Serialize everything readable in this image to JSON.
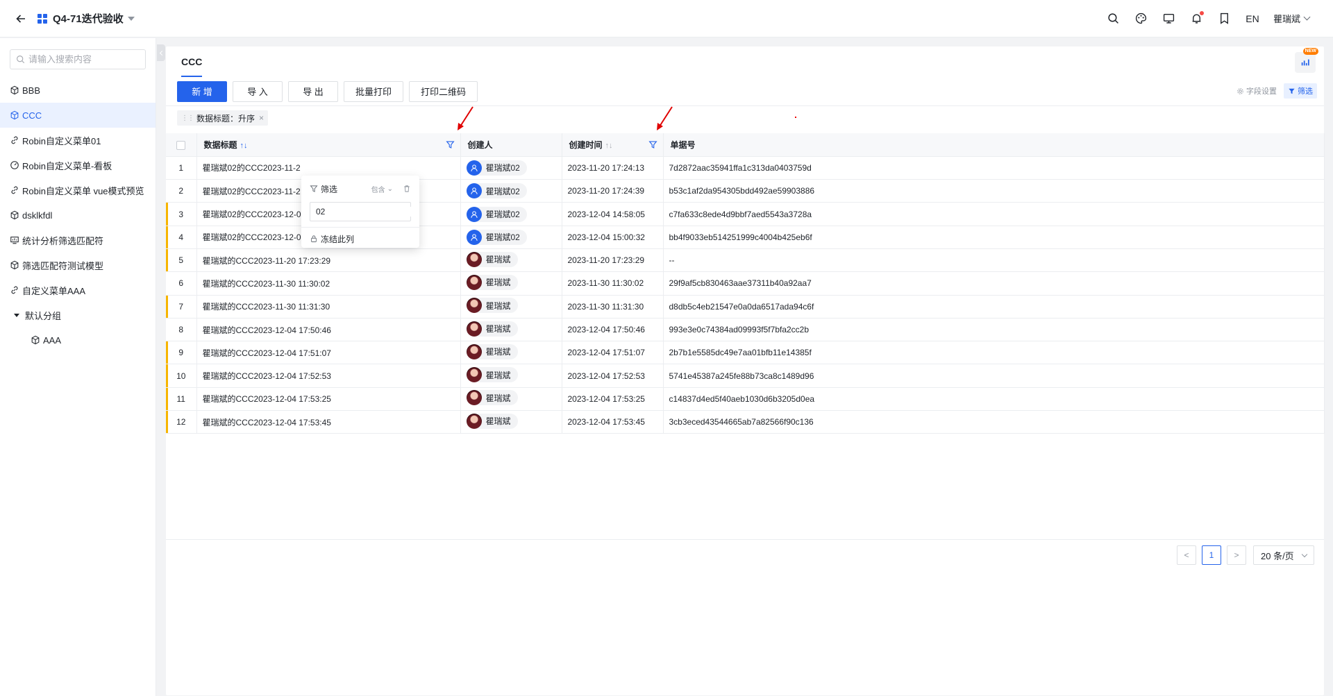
{
  "header": {
    "app_title": "Q4-71迭代验收",
    "lang": "EN",
    "user": "瞿瑞斌",
    "icons": [
      "search-icon",
      "palette-icon",
      "monitor-icon",
      "bell-icon",
      "bookmark-icon"
    ]
  },
  "sidebar": {
    "search_placeholder": "请输入搜索内容",
    "items": [
      {
        "label": "BBB",
        "icon": "cube-icon"
      },
      {
        "label": "CCC",
        "icon": "cube-icon",
        "active": true
      },
      {
        "label": "Robin自定义菜单01",
        "icon": "link-icon"
      },
      {
        "label": "Robin自定义菜单-看板",
        "icon": "dashboard-icon"
      },
      {
        "label": "Robin自定义菜单 vue模式预览",
        "icon": "link-icon"
      },
      {
        "label": "dsklkfdl",
        "icon": "cube-icon"
      },
      {
        "label": "统计分析筛选匹配符",
        "icon": "chart-icon"
      },
      {
        "label": "筛选匹配符测试模型",
        "icon": "cube-icon"
      },
      {
        "label": "自定义菜单AAA",
        "icon": "link-icon"
      }
    ],
    "group": {
      "label": "默认分组",
      "children": [
        {
          "label": "AAA",
          "icon": "cube-icon"
        }
      ]
    }
  },
  "main": {
    "tab": "CCC",
    "new_badge": "NEW",
    "toolbar": {
      "add": "新 增",
      "import": "导 入",
      "export": "导 出",
      "batch_print": "批量打印",
      "print_qr": "打印二维码",
      "field_settings": "字段设置",
      "filter": "筛选"
    },
    "sort_tag": "数据标题：升序",
    "columns": {
      "title": "数据标题",
      "creator": "创建人",
      "created_at": "创建时间",
      "doc_no": "单据号"
    },
    "rows": [
      {
        "n": "1",
        "title": "瞿瑞斌02的CCC2023-11-2",
        "creator": "瞿瑞斌02",
        "avatar": "blue",
        "time": "2023-11-20 17:24:13",
        "no": "7d2872aac35941ffa1c313da0403759d",
        "mark": false
      },
      {
        "n": "2",
        "title": "瞿瑞斌02的CCC2023-11-2",
        "creator": "瞿瑞斌02",
        "avatar": "blue",
        "time": "2023-11-20 17:24:39",
        "no": "b53c1af2da954305bdd492ae59903886",
        "mark": false
      },
      {
        "n": "3",
        "title": "瞿瑞斌02的CCC2023-12-0",
        "creator": "瞿瑞斌02",
        "avatar": "blue",
        "time": "2023-12-04 14:58:05",
        "no": "c7fa633c8ede4d9bbf7aed5543a3728a",
        "mark": true
      },
      {
        "n": "4",
        "title": "瞿瑞斌02的CCC2023-12-0",
        "creator": "瞿瑞斌02",
        "avatar": "blue",
        "time": "2023-12-04 15:00:32",
        "no": "bb4f9033eb514251999c4004b425eb6f",
        "mark": true
      },
      {
        "n": "5",
        "title": "瞿瑞斌的CCC2023-11-20 17:23:29",
        "creator": "瞿瑞斌",
        "avatar": "photo",
        "time": "2023-11-20 17:23:29",
        "no": "--",
        "mark": true
      },
      {
        "n": "6",
        "title": "瞿瑞斌的CCC2023-11-30 11:30:02",
        "creator": "瞿瑞斌",
        "avatar": "photo",
        "time": "2023-11-30 11:30:02",
        "no": "29f9af5cb830463aae37311b40a92aa7",
        "mark": false
      },
      {
        "n": "7",
        "title": "瞿瑞斌的CCC2023-11-30 11:31:30",
        "creator": "瞿瑞斌",
        "avatar": "photo",
        "time": "2023-11-30 11:31:30",
        "no": "d8db5c4eb21547e0a0da6517ada94c6f",
        "mark": true
      },
      {
        "n": "8",
        "title": "瞿瑞斌的CCC2023-12-04 17:50:46",
        "creator": "瞿瑞斌",
        "avatar": "photo",
        "time": "2023-12-04 17:50:46",
        "no": "993e3e0c74384ad09993f5f7bfa2cc2b",
        "mark": false
      },
      {
        "n": "9",
        "title": "瞿瑞斌的CCC2023-12-04 17:51:07",
        "creator": "瞿瑞斌",
        "avatar": "photo",
        "time": "2023-12-04 17:51:07",
        "no": "2b7b1e5585dc49e7aa01bfb11e14385f",
        "mark": true
      },
      {
        "n": "10",
        "title": "瞿瑞斌的CCC2023-12-04 17:52:53",
        "creator": "瞿瑞斌",
        "avatar": "photo",
        "time": "2023-12-04 17:52:53",
        "no": "5741e45387a245fe88b73ca8c1489d96",
        "mark": true
      },
      {
        "n": "11",
        "title": "瞿瑞斌的CCC2023-12-04 17:53:25",
        "creator": "瞿瑞斌",
        "avatar": "photo",
        "time": "2023-12-04 17:53:25",
        "no": "c14837d4ed5f40aeb1030d6b3205d0ea",
        "mark": true
      },
      {
        "n": "12",
        "title": "瞿瑞斌的CCC2023-12-04 17:53:45",
        "creator": "瞿瑞斌",
        "avatar": "photo",
        "time": "2023-12-04 17:53:45",
        "no": "3cb3eced43544665ab7a82566f90c136",
        "mark": true
      }
    ],
    "filter_popup": {
      "title": "筛选",
      "mode": "包含",
      "value": "02",
      "freeze": "冻结此列"
    },
    "pager": {
      "current": "1",
      "prev": "<",
      "next": ">",
      "page_size": "20 条/页"
    }
  },
  "colors": {
    "accent": "#2463eb",
    "row_mark": "#f7b500",
    "annotation": "#e00000"
  }
}
